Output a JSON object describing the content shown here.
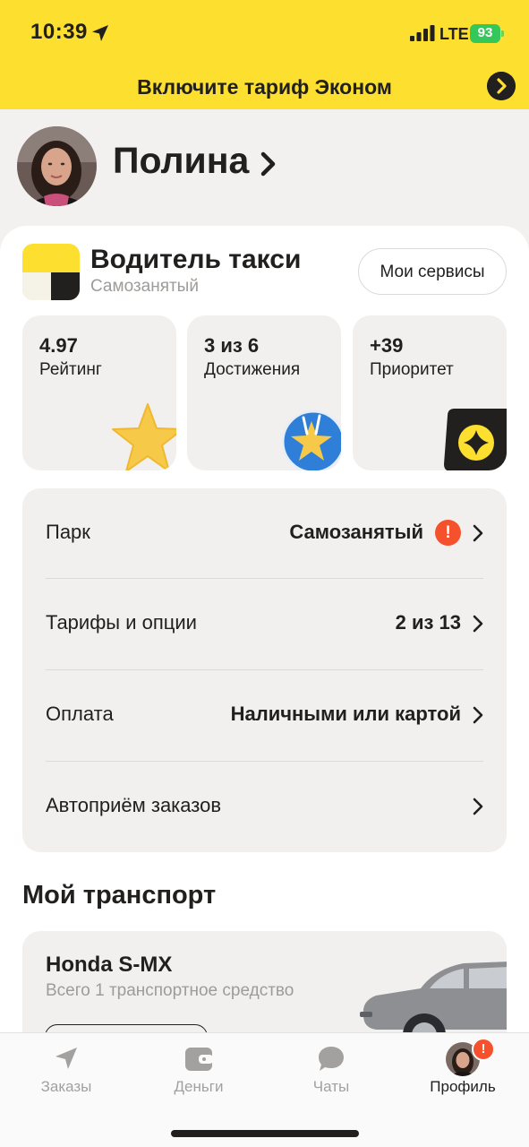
{
  "status_bar": {
    "time": "10:39",
    "network": "LTE",
    "battery": "93",
    "icons": [
      "location-arrow-icon",
      "signal-bars-icon",
      "battery-icon"
    ]
  },
  "promo_banner": {
    "text": "Включите тариф Эконом",
    "icon": "chevron-right-icon"
  },
  "profile": {
    "name": "Полина",
    "icon": "chevron-right-icon"
  },
  "role": {
    "title": "Водитель такси",
    "subtitle": "Самозанятый",
    "services_button": "Мои сервисы"
  },
  "stats": [
    {
      "value": "4.97",
      "label": "Рейтинг",
      "icon": "star-icon"
    },
    {
      "value": "3 из 6",
      "label": "Достижения",
      "icon": "achievement-badge-icon"
    },
    {
      "value": "+39",
      "label": "Приоритет",
      "icon": "priority-icon"
    }
  ],
  "settings": [
    {
      "label": "Парк",
      "value": "Самозанятый",
      "warning": "!"
    },
    {
      "label": "Тарифы и опции",
      "value": "2 из 13"
    },
    {
      "label": "Оплата",
      "value": "Наличными или картой"
    },
    {
      "label": "Автоприём заказов",
      "value": ""
    }
  ],
  "transport": {
    "title": "Мой транспорт",
    "vehicle_name": "Honda S-MX",
    "vehicle_sub": "Всего 1 транспортное средство"
  },
  "tabbar": {
    "tabs": [
      {
        "label": "Заказы",
        "icon": "navigation-arrow-icon"
      },
      {
        "label": "Деньги",
        "icon": "wallet-icon"
      },
      {
        "label": "Чаты",
        "icon": "chat-bubble-icon"
      },
      {
        "label": "Профиль",
        "icon": "avatar-icon"
      }
    ],
    "profile_badge": "!",
    "active": "Профиль"
  },
  "colors": {
    "brand_yellow": "#fcdf2f",
    "warning_red": "#f4512c",
    "battery_green": "#34c759",
    "text": "#21201f",
    "muted": "#9e9b98"
  }
}
